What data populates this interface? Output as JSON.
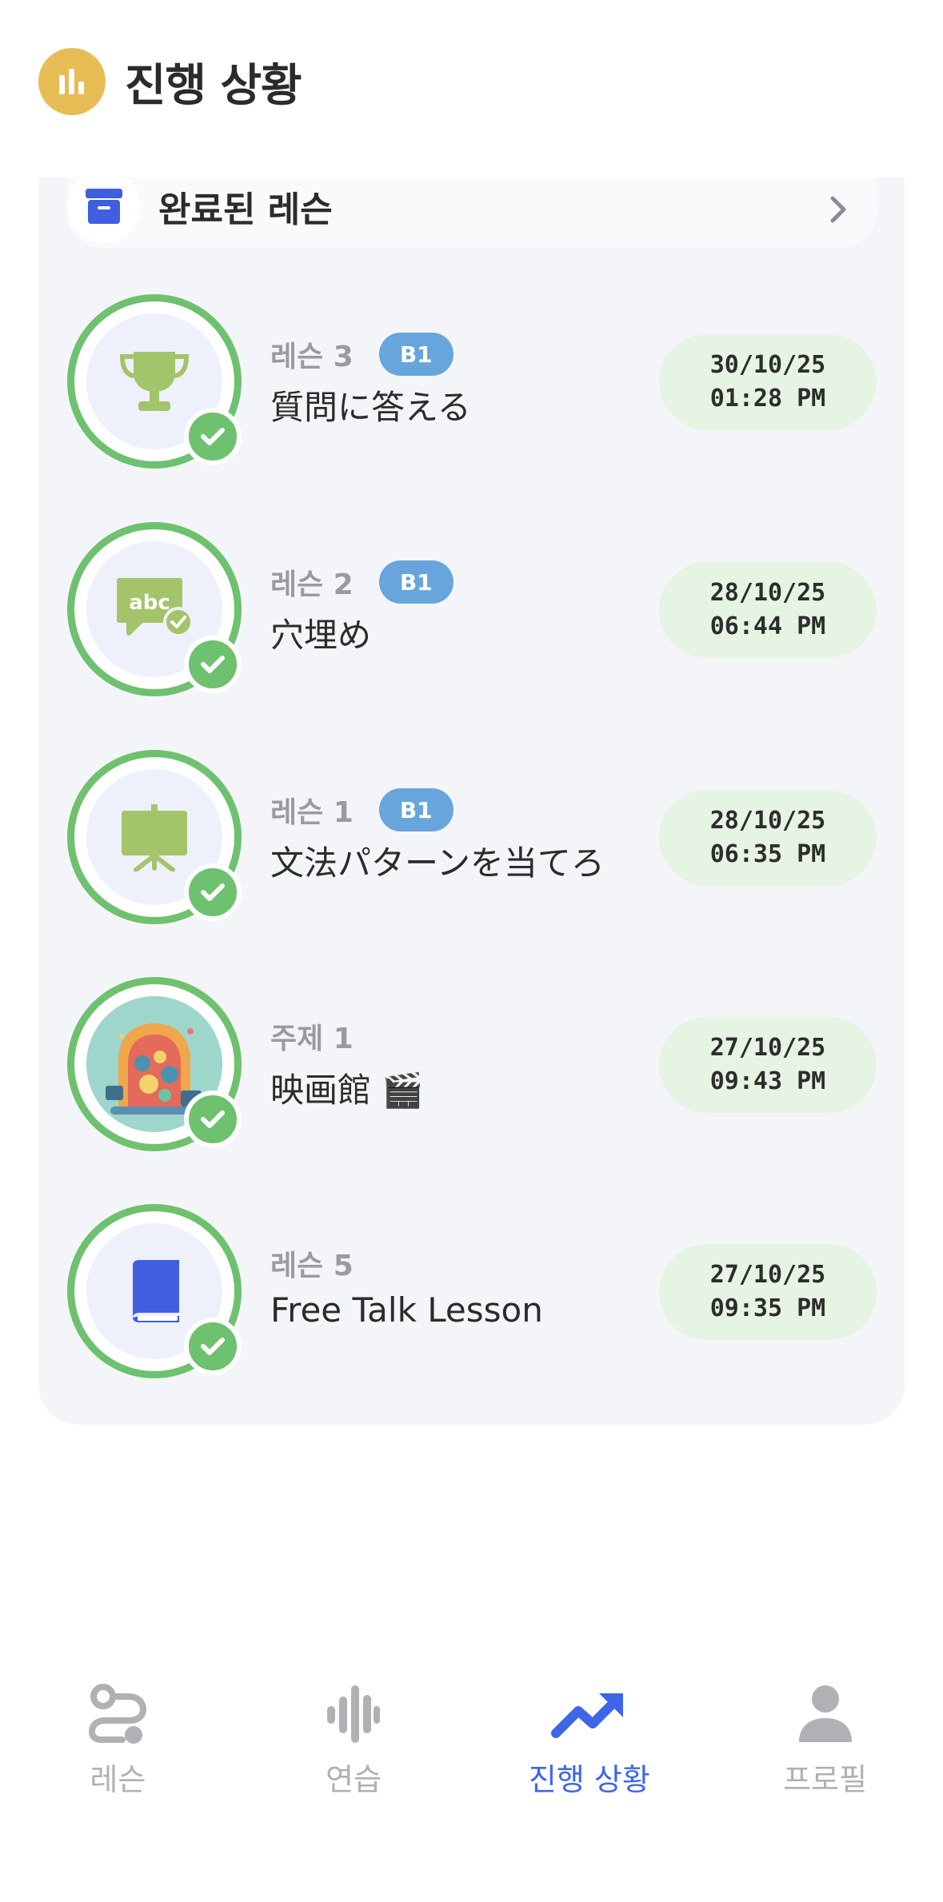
{
  "header": {
    "title": "진행 상황",
    "icon": "bar-chart-icon"
  },
  "archive": {
    "label": "완료된 레슨",
    "icon": "archive-box-icon"
  },
  "lessons": [
    {
      "kicker": "레슨 3",
      "badge": "B1",
      "title": "質問に答える",
      "date": "30/10/25",
      "time": "01:28 PM",
      "icon": "trophy-icon"
    },
    {
      "kicker": "레슨 2",
      "badge": "B1",
      "title": "穴埋め",
      "date": "28/10/25",
      "time": "06:44 PM",
      "icon": "abc-speech-bubble-icon"
    },
    {
      "kicker": "레슨 1",
      "badge": "B1",
      "title": "文法パターンを当てろ",
      "date": "28/10/25",
      "time": "06:35 PM",
      "icon": "easel-board-icon"
    },
    {
      "kicker": "주제 1",
      "badge": "",
      "title": "映画館 🎬",
      "date": "27/10/25",
      "time": "09:43 PM",
      "icon": "cinema-illustration-icon"
    },
    {
      "kicker": "레슨 5",
      "badge": "",
      "title": "Free Talk Lesson",
      "date": "27/10/25",
      "time": "09:35 PM",
      "icon": "book-icon"
    }
  ],
  "nav": {
    "items": [
      {
        "label": "레슨",
        "icon": "path-icon",
        "active": false
      },
      {
        "label": "연습",
        "icon": "waveform-icon",
        "active": false
      },
      {
        "label": "진행 상황",
        "icon": "trending-up-icon",
        "active": true
      },
      {
        "label": "프로필",
        "icon": "user-icon",
        "active": false
      }
    ]
  },
  "colors": {
    "accent": "#3d66e8",
    "success": "#6ec16e",
    "badge": "#67a5dc",
    "header_icon": "#e6bd55",
    "date_pill": "#e6f5e3"
  }
}
